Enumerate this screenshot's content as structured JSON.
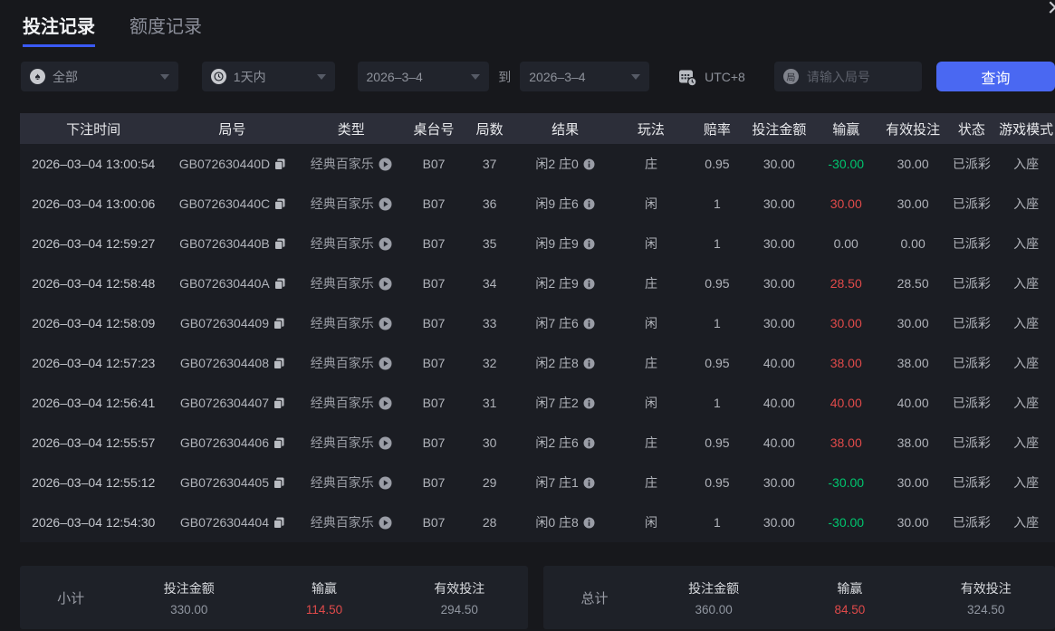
{
  "colors": {
    "accent_blue": "#4a68f2",
    "tab_underline": "#3a5af5",
    "win_red": "#e04a4a",
    "win_green": "#00c46e",
    "header_bg": "#2c2e39",
    "page_bg": "#17181c"
  },
  "icons": {
    "close": "×",
    "spade": "♠",
    "round_badge": "局",
    "caret": "▼"
  },
  "tabs": [
    {
      "label": "投注记录",
      "active": true
    },
    {
      "label": "额度记录",
      "active": false
    }
  ],
  "filters": {
    "category": {
      "value": "全部"
    },
    "range": {
      "value": "1天内"
    },
    "date_from": "2026–3–4",
    "to_label": "到",
    "date_to": "2026–3–4",
    "timezone_label": "UTC+8",
    "search": {
      "placeholder": "请输入局号",
      "value": ""
    },
    "query_label": "查询"
  },
  "table": {
    "headers": [
      "下注时间",
      "局号",
      "类型",
      "桌台号",
      "局数",
      "结果",
      "玩法",
      "赔率",
      "投注金额",
      "输赢",
      "有效投注",
      "状态",
      "游戏模式"
    ],
    "rows": [
      {
        "time": "2026–03–04 13:00:54",
        "round_id": "GB072630440D",
        "type": "经典百家乐",
        "table_no": "B07",
        "round_no": "37",
        "result": "闲2 庄0",
        "play": "庄",
        "odds": "0.95",
        "bet": "30.00",
        "win": "-30.00",
        "win_color": "green",
        "valid": "30.00",
        "status": "已派彩",
        "mode": "入座"
      },
      {
        "time": "2026–03–04 13:00:06",
        "round_id": "GB072630440C",
        "type": "经典百家乐",
        "table_no": "B07",
        "round_no": "36",
        "result": "闲9 庄6",
        "play": "闲",
        "odds": "1",
        "bet": "30.00",
        "win": "30.00",
        "win_color": "red",
        "valid": "30.00",
        "status": "已派彩",
        "mode": "入座"
      },
      {
        "time": "2026–03–04 12:59:27",
        "round_id": "GB072630440B",
        "type": "经典百家乐",
        "table_no": "B07",
        "round_no": "35",
        "result": "闲9 庄9",
        "play": "闲",
        "odds": "1",
        "bet": "30.00",
        "win": "0.00",
        "win_color": "neutral",
        "valid": "0.00",
        "status": "已派彩",
        "mode": "入座"
      },
      {
        "time": "2026–03–04 12:58:48",
        "round_id": "GB072630440A",
        "type": "经典百家乐",
        "table_no": "B07",
        "round_no": "34",
        "result": "闲2 庄9",
        "play": "庄",
        "odds": "0.95",
        "bet": "30.00",
        "win": "28.50",
        "win_color": "red",
        "valid": "28.50",
        "status": "已派彩",
        "mode": "入座"
      },
      {
        "time": "2026–03–04 12:58:09",
        "round_id": "GB0726304409",
        "type": "经典百家乐",
        "table_no": "B07",
        "round_no": "33",
        "result": "闲7 庄6",
        "play": "闲",
        "odds": "1",
        "bet": "30.00",
        "win": "30.00",
        "win_color": "red",
        "valid": "30.00",
        "status": "已派彩",
        "mode": "入座"
      },
      {
        "time": "2026–03–04 12:57:23",
        "round_id": "GB0726304408",
        "type": "经典百家乐",
        "table_no": "B07",
        "round_no": "32",
        "result": "闲2 庄8",
        "play": "庄",
        "odds": "0.95",
        "bet": "40.00",
        "win": "38.00",
        "win_color": "red",
        "valid": "38.00",
        "status": "已派彩",
        "mode": "入座"
      },
      {
        "time": "2026–03–04 12:56:41",
        "round_id": "GB0726304407",
        "type": "经典百家乐",
        "table_no": "B07",
        "round_no": "31",
        "result": "闲7 庄2",
        "play": "闲",
        "odds": "1",
        "bet": "40.00",
        "win": "40.00",
        "win_color": "red",
        "valid": "40.00",
        "status": "已派彩",
        "mode": "入座"
      },
      {
        "time": "2026–03–04 12:55:57",
        "round_id": "GB0726304406",
        "type": "经典百家乐",
        "table_no": "B07",
        "round_no": "30",
        "result": "闲2 庄6",
        "play": "庄",
        "odds": "0.95",
        "bet": "40.00",
        "win": "38.00",
        "win_color": "red",
        "valid": "38.00",
        "status": "已派彩",
        "mode": "入座"
      },
      {
        "time": "2026–03–04 12:55:12",
        "round_id": "GB0726304405",
        "type": "经典百家乐",
        "table_no": "B07",
        "round_no": "29",
        "result": "闲7 庄1",
        "play": "庄",
        "odds": "0.95",
        "bet": "30.00",
        "win": "-30.00",
        "win_color": "green",
        "valid": "30.00",
        "status": "已派彩",
        "mode": "入座"
      },
      {
        "time": "2026–03–04 12:54:30",
        "round_id": "GB0726304404",
        "type": "经典百家乐",
        "table_no": "B07",
        "round_no": "28",
        "result": "闲0 庄8",
        "play": "闲",
        "odds": "1",
        "bet": "30.00",
        "win": "-30.00",
        "win_color": "green",
        "valid": "30.00",
        "status": "已派彩",
        "mode": "入座"
      }
    ]
  },
  "summary": {
    "subtotal": {
      "label": "小计",
      "bet_label": "投注金额",
      "bet": "330.00",
      "win_label": "输赢",
      "win": "114.50",
      "valid_label": "有效投注",
      "valid": "294.50"
    },
    "total": {
      "label": "总计",
      "bet_label": "投注金额",
      "bet": "360.00",
      "win_label": "输赢",
      "win": "84.50",
      "valid_label": "有效投注",
      "valid": "324.50"
    }
  }
}
